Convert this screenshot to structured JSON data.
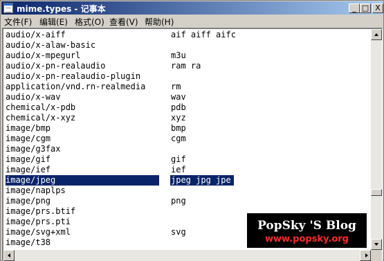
{
  "window": {
    "title": "mime.types - 记事本",
    "minimize_label": "_",
    "maximize_label": "□",
    "close_label": "X"
  },
  "menu": [
    {
      "label": "文件(F)"
    },
    {
      "label": "编辑(E)"
    },
    {
      "label": "格式(O)"
    },
    {
      "label": "查看(V)"
    },
    {
      "label": "帮助(H)"
    }
  ],
  "lines": [
    {
      "mime": "audio/x-aiff",
      "ext": "aif aiff aifc"
    },
    {
      "mime": "audio/x-alaw-basic",
      "ext": ""
    },
    {
      "mime": "audio/x-mpegurl",
      "ext": "m3u"
    },
    {
      "mime": "audio/x-pn-realaudio",
      "ext": "ram ra"
    },
    {
      "mime": "audio/x-pn-realaudio-plugin",
      "ext": ""
    },
    {
      "mime": "application/vnd.rn-realmedia",
      "ext": "rm"
    },
    {
      "mime": "audio/x-wav",
      "ext": "wav"
    },
    {
      "mime": "chemical/x-pdb",
      "ext": "pdb"
    },
    {
      "mime": "chemical/x-xyz",
      "ext": "xyz"
    },
    {
      "mime": "image/bmp",
      "ext": "bmp"
    },
    {
      "mime": "image/cgm",
      "ext": "cgm"
    },
    {
      "mime": "image/g3fax",
      "ext": ""
    },
    {
      "mime": "image/gif",
      "ext": "gif"
    },
    {
      "mime": "image/ief",
      "ext": "ief"
    },
    {
      "mime": "image/jpeg",
      "ext": "jpeg jpg jpe"
    },
    {
      "mime": "image/naplps",
      "ext": ""
    },
    {
      "mime": "image/png",
      "ext": "png"
    },
    {
      "mime": "image/prs.btif",
      "ext": ""
    },
    {
      "mime": "image/prs.pti",
      "ext": ""
    },
    {
      "mime": "image/svg+xml",
      "ext": "svg"
    },
    {
      "mime": "image/t38",
      "ext": ""
    }
  ],
  "selected_line": "image/jpeg",
  "watermark": {
    "title": "PopSky 'S Blog",
    "url": "www.popsky.org"
  },
  "colors": {
    "selection": "#0a246a",
    "title_gradient_start": "#0a246a",
    "title_gradient_end": "#a6caf0",
    "watermark_url": "#ff2a2a"
  },
  "icons": {
    "app": "notepad-icon",
    "scroll_up": "arrow-up-icon",
    "scroll_down": "arrow-down-icon",
    "scroll_left": "arrow-left-icon",
    "scroll_right": "arrow-right-icon"
  }
}
